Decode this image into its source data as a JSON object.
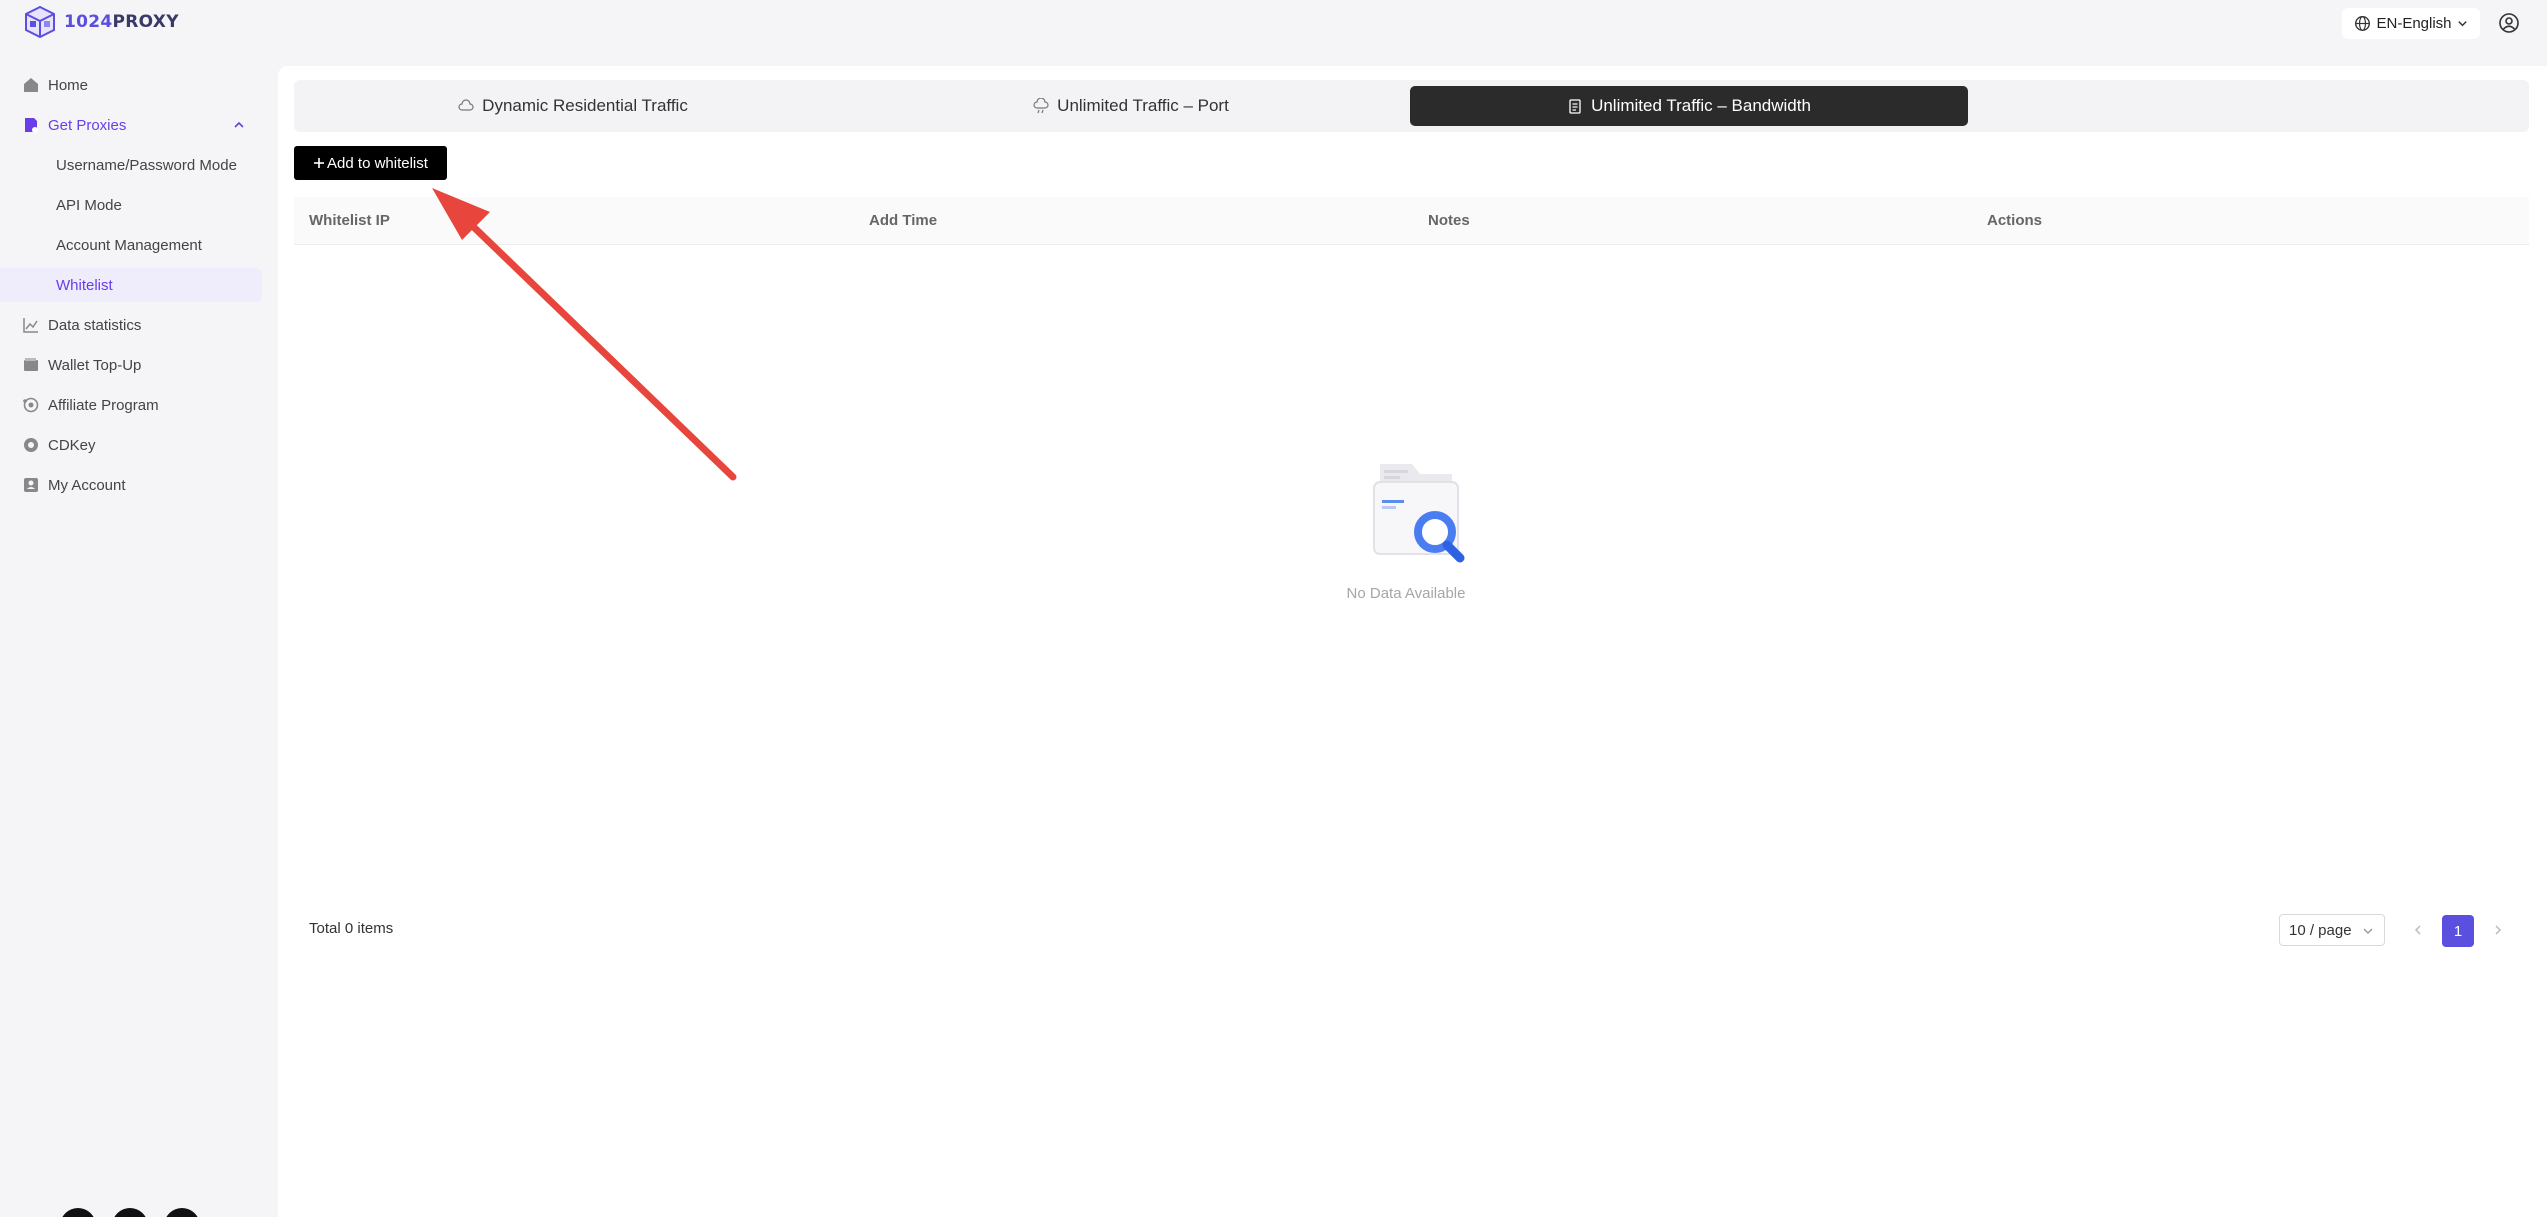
{
  "brand": {
    "logo_num": "1024",
    "logo_word": "PROXY"
  },
  "header": {
    "language": "EN-English"
  },
  "sidebar": {
    "items": [
      {
        "label": "Home"
      },
      {
        "label": "Get Proxies"
      },
      {
        "label": "Data statistics"
      },
      {
        "label": "Wallet Top-Up"
      },
      {
        "label": "Affiliate Program"
      },
      {
        "label": "CDKey"
      },
      {
        "label": "My Account"
      }
    ],
    "sub_items": [
      {
        "label": "Username/Password Mode"
      },
      {
        "label": "API Mode"
      },
      {
        "label": "Account Management"
      },
      {
        "label": "Whitelist"
      }
    ]
  },
  "tabs": [
    {
      "label": "Dynamic Residential Traffic"
    },
    {
      "label": "Unlimited Traffic – Port"
    },
    {
      "label": "Unlimited Traffic – Bandwidth"
    }
  ],
  "toolbar": {
    "add_label": "Add to whitelist"
  },
  "table": {
    "columns": [
      "Whitelist IP",
      "Add Time",
      "Notes",
      "Actions"
    ],
    "rows": [],
    "empty_text": "No Data Available"
  },
  "pagination": {
    "total": "Total 0 items",
    "page_size": "10 / page",
    "current_page": "1"
  },
  "colors": {
    "accent": "#5b4fe0",
    "active_tab": "#2b2b2b",
    "annotation_arrow": "#e8453c"
  }
}
